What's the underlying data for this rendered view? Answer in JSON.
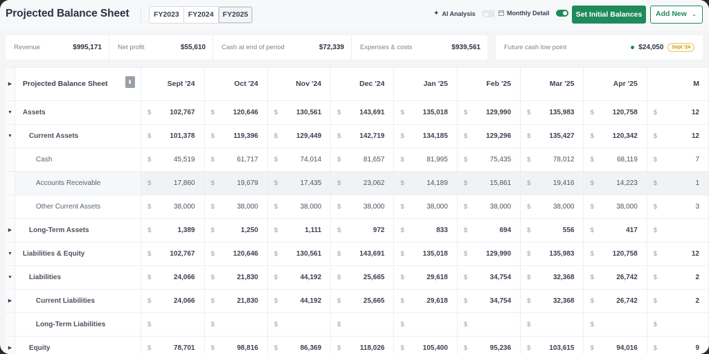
{
  "header": {
    "title": "Projected Balance Sheet",
    "fiscal_years": [
      {
        "label": "FY2023",
        "active": false
      },
      {
        "label": "FY2024",
        "active": false
      },
      {
        "label": "FY2025",
        "active": true
      }
    ],
    "ai_analysis": {
      "label": "AI Analysis",
      "icon": "sparkle-icon",
      "enabled": false
    },
    "monthly_detail": {
      "label": "Monthly Detail",
      "icon": "calendar-icon",
      "enabled": true
    },
    "set_initial_balances_label": "Set Initial Balances",
    "add_new_label": "Add New",
    "accent_color": "#1f8a5b"
  },
  "summary": {
    "metrics": [
      {
        "label": "Revenue",
        "value": "$995,171"
      },
      {
        "label": "Net profit",
        "value": "$55,610"
      },
      {
        "label": "Cash at end of period",
        "value": "$72,339"
      },
      {
        "label": "Expenses & costs",
        "value": "$939,561"
      }
    ],
    "low_point": {
      "label": "Future cash low point",
      "value": "$24,050",
      "badge": "Sept '24",
      "status_color": "#1f8a5b"
    }
  },
  "table": {
    "header_label": "Projected Balance Sheet",
    "currency_symbol": "$",
    "columns": [
      "Sept '24",
      "Oct '24",
      "Nov '24",
      "Dec '24",
      "Jan '25",
      "Feb '25",
      "Mar '25",
      "Apr '25",
      "M"
    ],
    "rows": [
      {
        "label": "Assets",
        "level": 0,
        "toggle": "expanded",
        "values": [
          "102,767",
          "120,646",
          "130,561",
          "143,691",
          "135,018",
          "129,990",
          "135,983",
          "120,758",
          "12"
        ]
      },
      {
        "label": "Current Assets",
        "level": 1,
        "toggle": "expanded",
        "values": [
          "101,378",
          "119,396",
          "129,449",
          "142,719",
          "134,185",
          "129,296",
          "135,427",
          "120,342",
          "12"
        ]
      },
      {
        "label": "Cash",
        "level": 2,
        "toggle": "none",
        "values": [
          "45,519",
          "61,717",
          "74,014",
          "81,657",
          "81,995",
          "75,435",
          "78,012",
          "68,119",
          "7"
        ]
      },
      {
        "label": "Accounts Receivable",
        "level": 2,
        "toggle": "none",
        "highlighted": true,
        "values": [
          "17,860",
          "19,679",
          "17,435",
          "23,062",
          "14,189",
          "15,861",
          "19,416",
          "14,223",
          "1"
        ]
      },
      {
        "label": "Other Current Assets",
        "level": 2,
        "toggle": "none",
        "values": [
          "38,000",
          "38,000",
          "38,000",
          "38,000",
          "38,000",
          "38,000",
          "38,000",
          "38,000",
          "3"
        ]
      },
      {
        "label": "Long-Term Assets",
        "level": 1,
        "toggle": "collapsed",
        "values": [
          "1,389",
          "1,250",
          "1,111",
          "972",
          "833",
          "694",
          "556",
          "417",
          ""
        ]
      },
      {
        "label": "Liabilities & Equity",
        "level": 0,
        "toggle": "expanded",
        "values": [
          "102,767",
          "120,646",
          "130,561",
          "143,691",
          "135,018",
          "129,990",
          "135,983",
          "120,758",
          "12"
        ]
      },
      {
        "label": "Liabilities",
        "level": 1,
        "toggle": "expanded",
        "values": [
          "24,066",
          "21,830",
          "44,192",
          "25,665",
          "29,618",
          "34,754",
          "32,368",
          "26,742",
          "2"
        ]
      },
      {
        "label": "Current Liabilities",
        "level": 2,
        "toggle": "collapsed",
        "bold": true,
        "values": [
          "24,066",
          "21,830",
          "44,192",
          "25,665",
          "29,618",
          "34,754",
          "32,368",
          "26,742",
          "2"
        ]
      },
      {
        "label": "Long-Term Liabilities",
        "level": 2,
        "toggle": "none",
        "bold": true,
        "values": [
          "",
          "",
          "",
          "",
          "",
          "",
          "",
          "",
          ""
        ]
      },
      {
        "label": "Equity",
        "level": 1,
        "toggle": "collapsed",
        "values": [
          "78,701",
          "98,816",
          "86,369",
          "118,026",
          "105,400",
          "95,236",
          "103,615",
          "94,016",
          "9"
        ]
      }
    ]
  }
}
